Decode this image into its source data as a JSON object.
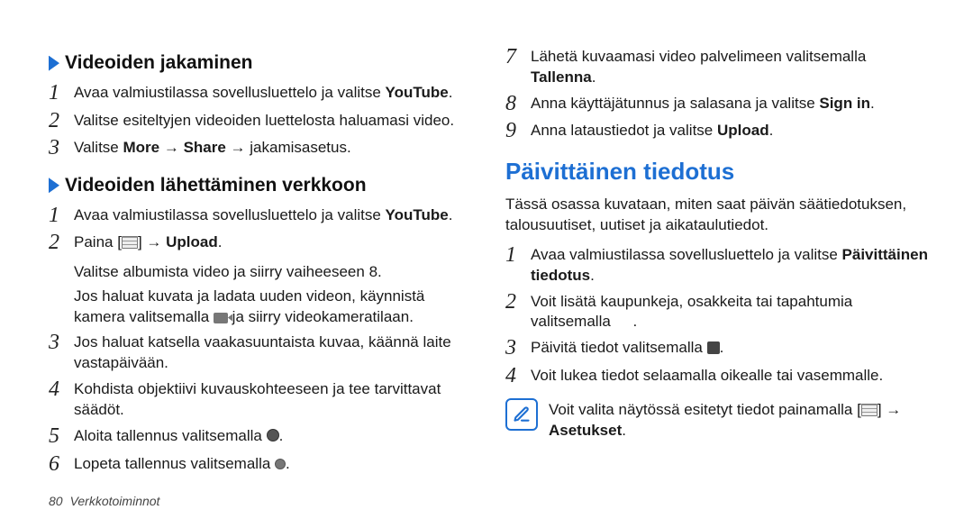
{
  "left": {
    "sub1": "Videoiden jakaminen",
    "s1_1_a": "Avaa valmiustilassa sovellusluettelo ja valitse ",
    "s1_1_b": "YouTube",
    "s1_1_c": ".",
    "s1_2": "Valitse esiteltyjen videoiden luettelosta haluamasi video.",
    "s1_3_a": "Valitse ",
    "s1_3_b": "More",
    "s1_3_c": " → ",
    "s1_3_d": "Share",
    "s1_3_e": " → jakamisasetus.",
    "sub2": "Videoiden lähettäminen verkkoon",
    "s2_1_a": "Avaa valmiustilassa sovellusluettelo ja valitse ",
    "s2_1_b": "YouTube",
    "s2_1_c": ".",
    "s2_2_a": "Paina [",
    "s2_2_b": "] → ",
    "s2_2_c": "Upload",
    "s2_2_d": ".",
    "s2_note1": "Valitse albumista video ja siirry vaiheeseen 8.",
    "s2_note2_a": "Jos haluat kuvata ja ladata uuden videon, käynnistä kamera valitsemalla ",
    "s2_note2_b": " ja siirry videokameratilaan.",
    "s2_3": "Jos haluat katsella vaakasuuntaista kuvaa, käännä laite vastapäivään.",
    "s2_4": "Kohdista objektiivi kuvauskohteeseen ja tee tarvittavat säädöt.",
    "s2_5_a": "Aloita tallennus valitsemalla ",
    "s2_5_b": ".",
    "s2_6_a": "Lopeta tallennus valitsemalla ",
    "s2_6_b": "."
  },
  "right": {
    "s7_a": "Lähetä kuvaamasi video palvelimeen valitsemalla ",
    "s7_b": "Tallenna",
    "s7_c": ".",
    "s8_a": "Anna käyttäjätunnus ja salasana ja valitse ",
    "s8_b": "Sign in",
    "s8_c": ".",
    "s9_a": "Anna lataustiedot ja valitse ",
    "s9_b": "Upload",
    "s9_c": ".",
    "section": "Päivittäinen tiedotus",
    "intro": "Tässä osassa kuvataan, miten saat päivän säätiedotuksen, talousuutiset, uutiset ja aikataulutiedot.",
    "p1_a": "Avaa valmiustilassa sovellusluettelo ja valitse ",
    "p1_b": "Päivittäinen tiedotus",
    "p1_c": ".",
    "p2_a": "Voit lisätä kaupunkeja, osakkeita tai tapahtumia valitsemalla ",
    "p2_b": ".",
    "p3_a": "Päivitä tiedot valitsemalla ",
    "p3_b": ".",
    "p4": "Voit lukea tiedot selaamalla oikealle tai vasemmalle.",
    "note_a": "Voit valita näytössä esitetyt tiedot painamalla [",
    "note_b": "] → ",
    "note_c": "Asetukset",
    "note_d": "."
  },
  "footer": {
    "page": "80",
    "chapter": "Verkkotoiminnot"
  },
  "nums": {
    "1": "1",
    "2": "2",
    "3": "3",
    "4": "4",
    "5": "5",
    "6": "6",
    "7": "7",
    "8": "8",
    "9": "9"
  }
}
